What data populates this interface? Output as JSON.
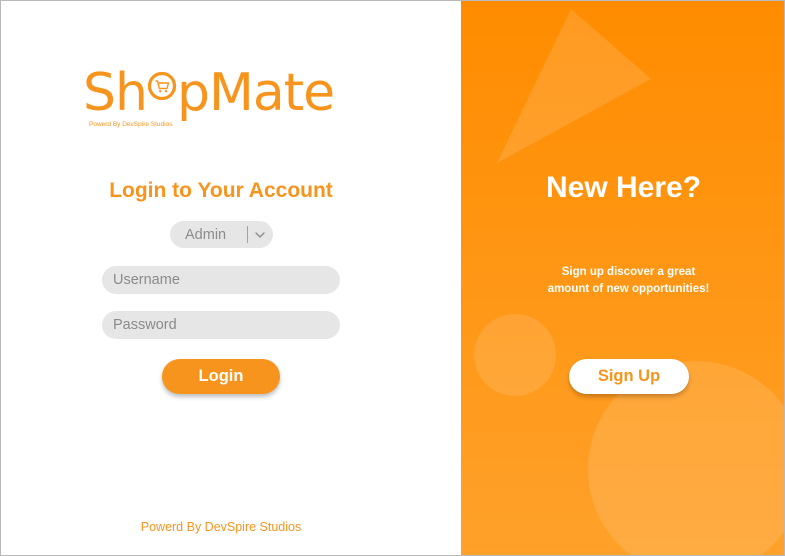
{
  "brand": {
    "name_part1": "Sh",
    "name_part2": "pMate",
    "tagline": "Powerd By DevSpire Studios",
    "color": "#f7941d"
  },
  "login": {
    "title": "Login to Your Account",
    "role": {
      "selected": "Admin"
    },
    "username_placeholder": "Username",
    "password_placeholder": "Password",
    "button_label": "Login"
  },
  "footer": {
    "credit": "Powerd By DevSpire Studios"
  },
  "signup_panel": {
    "heading": "New Here?",
    "line1": "Sign up discover a great",
    "line2": "amount of new opportunities!",
    "button_label": "Sign Up",
    "background": "#ff8c00",
    "accent": "#ffffff"
  },
  "icons": {
    "logo_o": "shopping-cart-icon",
    "role_dropdown": "chevron-down-icon"
  }
}
